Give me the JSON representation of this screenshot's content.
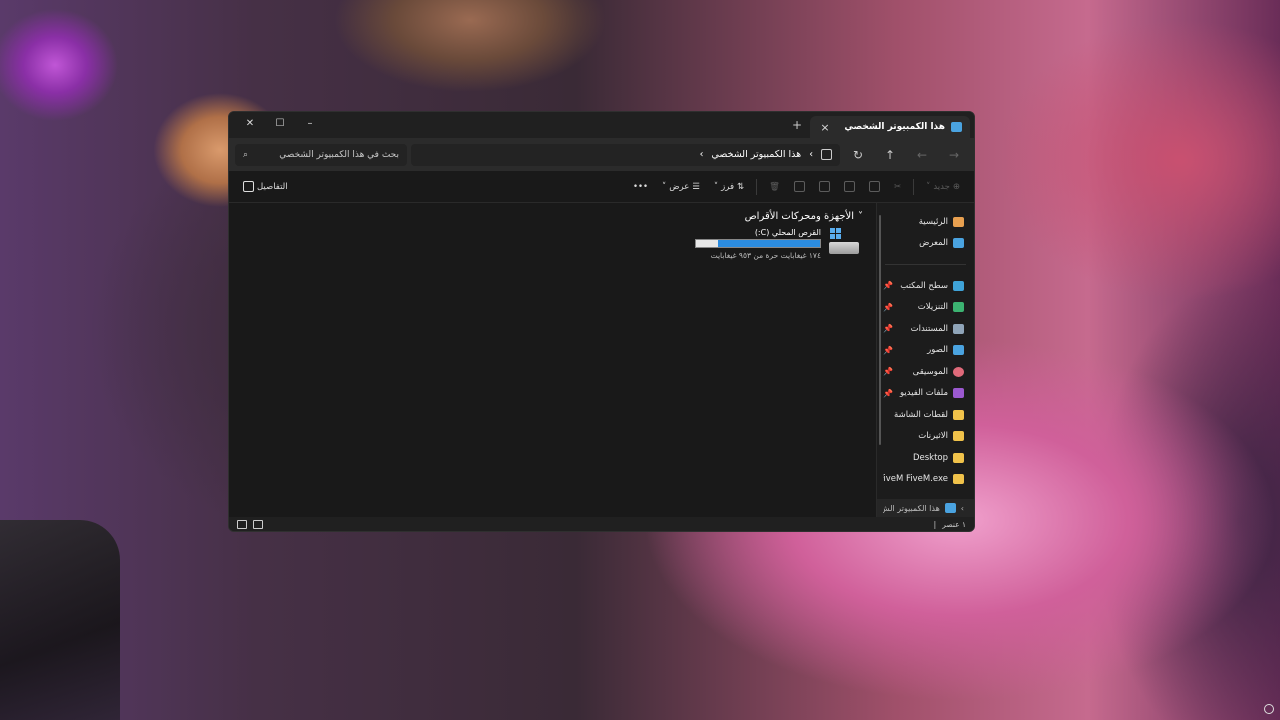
{
  "window": {
    "tab_title": "هذا الكمبيوتر الشخصي",
    "tab_close": "×",
    "new_tab": "+",
    "controls": {
      "minimize": "–",
      "maximize": "☐",
      "close": "✕"
    }
  },
  "nav": {
    "back": "←",
    "forward": "→",
    "up": "↑",
    "refresh": "↻",
    "address_chevron": "›",
    "address_path": "هذا الكمبيوتر الشخصي",
    "address_end_chevron": "›",
    "search_placeholder": "بحث في هذا الكمبيوتر الشخصي"
  },
  "toolbar": {
    "new_label": "جديد",
    "sort_label": "فرز",
    "view_label": "عرض",
    "more_label": "•••",
    "details_label": "التفاصيل"
  },
  "sidebar": {
    "top_items": [
      {
        "label": "الرئيسية",
        "icon": "home-icon"
      },
      {
        "label": "المعرض",
        "icon": "gallery-icon"
      }
    ],
    "pinned_items": [
      {
        "label": "سطح المكتب",
        "pin": "📌",
        "icon": "desktop-icon"
      },
      {
        "label": "التنزيلات",
        "pin": "📌",
        "icon": "download-icon"
      },
      {
        "label": "المستندات",
        "pin": "📌",
        "icon": "documents-icon"
      },
      {
        "label": "الصور",
        "pin": "📌",
        "icon": "pictures-icon"
      },
      {
        "label": "الموسيقى",
        "pin": "📌",
        "icon": "music-icon"
      },
      {
        "label": "ملفات الفيديو",
        "pin": "📌",
        "icon": "videos-icon"
      },
      {
        "label": "لقطات الشاشة",
        "icon": "folder-icon"
      },
      {
        "label": "الاثيرنات",
        "icon": "folder-icon"
      },
      {
        "label": "Desktop",
        "icon": "folder-icon"
      },
      {
        "label": "FiveM FiveM.exe",
        "icon": "folder-icon"
      }
    ],
    "bottom_label": "هذا الكمبيوتر الش"
  },
  "content": {
    "group_title": "الأجهزة ومحركات الأقراص",
    "drive": {
      "name": "القرص المحلي (C:)",
      "free_text": "١٧٤ غيغابايت حرة من ٩٥٣ غيغابايت",
      "used_fraction": 0.82
    }
  },
  "status": {
    "item_count": "١ عنصر"
  },
  "colors": {
    "accent": "#2b8ce0",
    "folder": "#f0c24a"
  }
}
